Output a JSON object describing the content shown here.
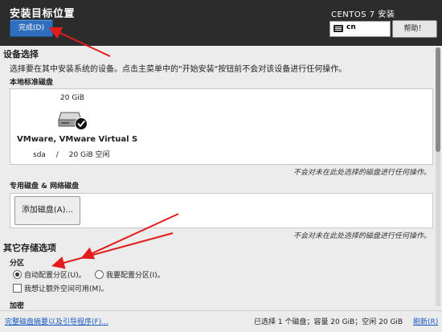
{
  "header": {
    "title": "安装目标位置",
    "done_label": "完成(D)",
    "product": "CENTOS 7 安装",
    "keyboard_layout": "cn",
    "help_label": "帮助！"
  },
  "device_selection": {
    "title": "设备选择",
    "description": "选择要在其中安装系统的设备。点击主菜单中的\"开始安装\"按钮前不会对该设备进行任何操作。",
    "local_disks_title": "本地标准磁盘",
    "disk": {
      "size": "20 GiB",
      "name": "VMware, VMware Virtual S",
      "device": "sda",
      "separator": "/",
      "free": "20 GiB 空闲"
    },
    "local_note": "不会对未在此处选择的磁盘进行任何操作。",
    "specialized_title": "专用磁盘 & 网络磁盘",
    "add_disk_label": "添加磁盘(A)...",
    "specialized_note": "不会对未在此处选择的磁盘进行任何操作。"
  },
  "other_storage": {
    "title": "其它存储选项",
    "partitioning_title": "分区",
    "auto_partition_label": "自动配置分区(U)。",
    "manual_partition_label": "我要配置分区(I)。",
    "extra_space_label": "我想让额外空间可用(M)。",
    "encryption_title": "加密"
  },
  "footer": {
    "summary_link": "完整磁盘摘要以及引导程序(F)...",
    "status": "已选择 1 个磁盘；容量 20 GiB；空闲 20 GiB",
    "refresh_link": "刷新(R)"
  },
  "colors": {
    "header_bg": "#2c2c2c",
    "primary_button": "#2f6fbd",
    "link": "#1a5bc5",
    "annotation_arrow": "#e01c1c"
  }
}
